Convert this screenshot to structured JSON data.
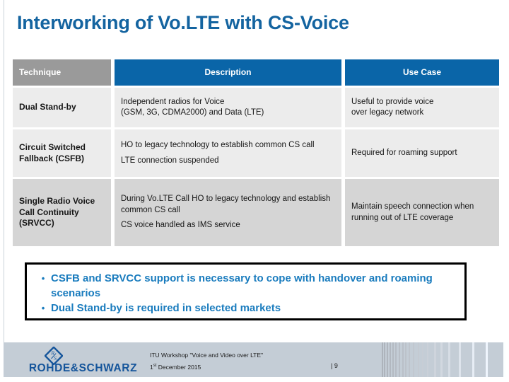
{
  "slide": {
    "title": "Interworking of Vo.LTE with CS-Voice"
  },
  "table": {
    "headers": [
      "Technique",
      "Description",
      "Use Case"
    ],
    "rows": [
      {
        "technique": "Dual Stand-by",
        "description": [
          "Independent radios for Voice",
          "(GSM, 3G, CDMA2000) and Data (LTE)"
        ],
        "use_case": [
          "Useful to provide voice",
          "over legacy network"
        ]
      },
      {
        "technique": "Circuit Switched Fallback (CSFB)",
        "description": [
          "HO to legacy technology to establish common CS call",
          "LTE connection suspended"
        ],
        "use_case": [
          "Required for roaming support"
        ]
      },
      {
        "technique": "Single Radio Voice Call Continuity (SRVCC)",
        "description": [
          "During Vo.LTE Call HO to legacy technology and establish common CS call",
          "CS voice handled as IMS service"
        ],
        "use_case": [
          "Maintain speech connection when running out of LTE coverage"
        ]
      }
    ]
  },
  "callout": {
    "bullet_char": "•",
    "items": [
      "CSFB and SRVCC support is necessary to cope with handover and roaming scenarios",
      "Dual Stand-by is required in selected markets"
    ]
  },
  "footer": {
    "logo_text": "ROHDE&SCHWARZ",
    "logo_mark": "rohde-schwarz-diamond-icon",
    "event": "ITU Workshop \"Voice and Video over LTE\"",
    "date_number": "1",
    "date_suffix": "st",
    "date_rest": " December 2015",
    "page": "|  9"
  },
  "colors": {
    "title_blue": "#1464a0",
    "header_blue": "#0a65a8",
    "header_gray": "#9a9a9a",
    "row_light": "#ececec",
    "row_dark": "#d5d5d5",
    "callout_blue": "#1a7cbe",
    "footer_bg": "#c4cdd6",
    "logo_blue": "#15559b"
  }
}
